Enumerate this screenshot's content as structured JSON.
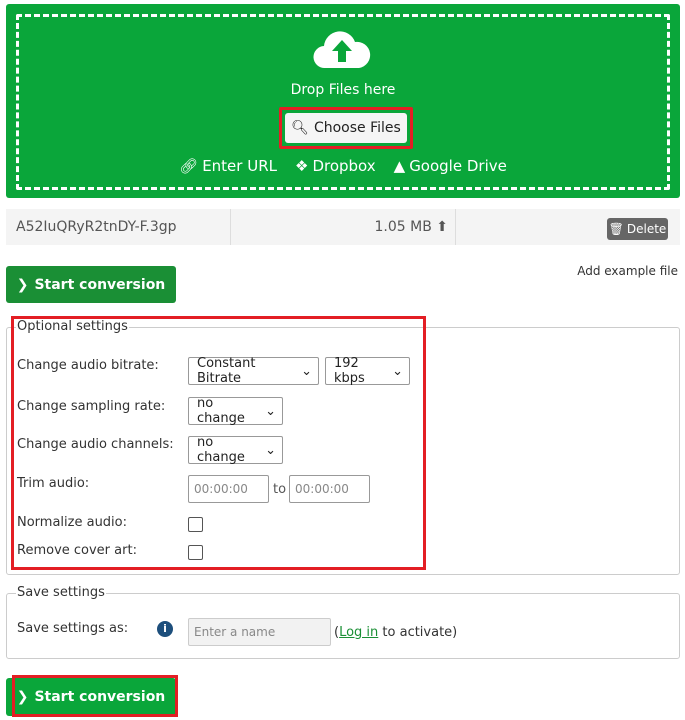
{
  "upload": {
    "drop_text": "Drop Files here",
    "choose_label": "Choose Files",
    "links": [
      "Enter URL",
      "Dropbox",
      "Google Drive"
    ]
  },
  "file": {
    "name": "A52IuQRyR2tnDY-F.3gp",
    "size": "1.05 MB",
    "delete_label": "Delete"
  },
  "start_label": "Start conversion",
  "add_example": "Add example file",
  "optional": {
    "legend": "Optional settings",
    "bitrate_label": "Change audio bitrate:",
    "bitrate_mode": "Constant Bitrate",
    "bitrate_value": "192 kbps",
    "sampling_label": "Change sampling rate:",
    "sampling_value": "no change",
    "channels_label": "Change audio channels:",
    "channels_value": "no change",
    "trim_label": "Trim audio:",
    "trim_from": "00:00:00",
    "trim_to_word": "to",
    "trim_to": "00:00:00",
    "normalize_label": "Normalize audio:",
    "normalize_checked": false,
    "cover_label": "Remove cover art:",
    "cover_checked": false
  },
  "save": {
    "legend": "Save settings",
    "label": "Save settings as:",
    "placeholder": "Enter a name",
    "paren_open": "(",
    "login": "Log in",
    "suffix": " to activate)"
  },
  "colors": {
    "green": "#0aa63a",
    "dark_green": "#1a8f35",
    "highlight": "#e31e24"
  }
}
